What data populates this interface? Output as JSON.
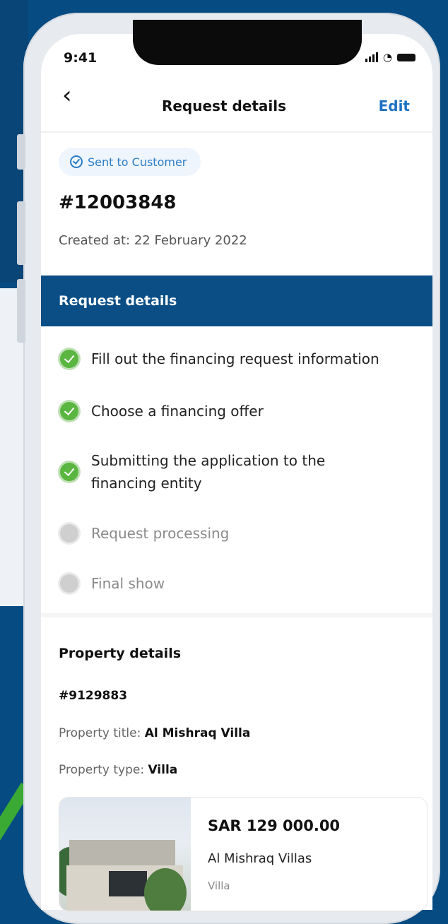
{
  "status_bar": {
    "time": "9:41"
  },
  "nav": {
    "title": "Request details",
    "edit_label": "Edit"
  },
  "request": {
    "badge": "Sent to Customer",
    "number": "#12003848",
    "created": "Created at: 22 February 2022"
  },
  "request_details": {
    "heading": "Request details",
    "steps": [
      {
        "label": "Fill out the financing request information",
        "status": "done"
      },
      {
        "label": "Choose a financing offer",
        "status": "done"
      },
      {
        "label": "Submitting the application to the",
        "label2": "financing entity",
        "status": "done"
      },
      {
        "label": "Request processing",
        "status": "pending"
      },
      {
        "label": "Final show",
        "status": "pending"
      }
    ]
  },
  "property": {
    "heading": "Property details",
    "id": "#9129883",
    "title_label": "Property title:",
    "title_value": "Al Mishraq Villa",
    "type_label": "Property type:",
    "type_value": "Villa",
    "card": {
      "price": "SAR 129 000.00",
      "name": "Al Mishraq Villas",
      "type": "Villa"
    }
  },
  "colors": {
    "background": "#064b82",
    "section_header": "#0b4e86",
    "accent": "#1d72c2",
    "done": "#5ab640",
    "pending": "#cfcfcf"
  },
  "icons": {
    "back": "chevron-left-icon",
    "badge": "check-circle-icon",
    "step_done": "check-circle-filled-icon",
    "step_pending": "circle-pending-icon"
  }
}
